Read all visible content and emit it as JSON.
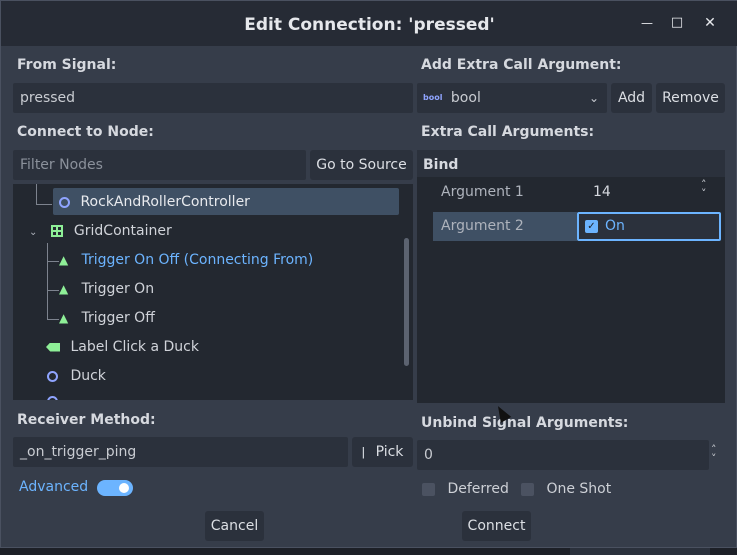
{
  "window": {
    "title": "Edit Connection: 'pressed'",
    "minimize_glyph": "—",
    "maximize_glyph": "□",
    "close_glyph": "✕"
  },
  "left": {
    "from_signal_label": "From Signal:",
    "from_signal_value": "pressed",
    "connect_to_node_label": "Connect to Node:",
    "filter_placeholder": "Filter Nodes",
    "go_to_source_label": "Go to Source",
    "tree": [
      {
        "label": "RockAndRollerController",
        "icon": "node-circle-icon",
        "selected": true
      },
      {
        "label": "GridContainer",
        "icon": "grid-container-icon",
        "expanded": true
      },
      {
        "label": "Trigger On Off (Connecting From)",
        "icon": "button-icon",
        "highlight": true
      },
      {
        "label": "Trigger On",
        "icon": "button-icon"
      },
      {
        "label": "Trigger Off",
        "icon": "button-icon"
      },
      {
        "label": "Label Click a Duck",
        "icon": "label-icon"
      },
      {
        "label": "Duck",
        "icon": "node-circle-icon"
      }
    ],
    "receiver_method_label": "Receiver Method:",
    "receiver_method_value": "_on_trigger_ping",
    "pick_label": "Pick",
    "advanced_label": "Advanced"
  },
  "right": {
    "add_extra_label": "Add Extra Call Argument:",
    "type_value": "bool",
    "type_icon_text": "bool",
    "add_label": "Add",
    "remove_label": "Remove",
    "extra_args_label": "Extra Call Arguments:",
    "bind_label": "Bind",
    "arguments": [
      {
        "name": "Argument 1",
        "value": "14"
      },
      {
        "name": "Argument 2",
        "value": "On",
        "checked": true
      }
    ],
    "unbind_label": "Unbind Signal Arguments:",
    "unbind_value": "0",
    "deferred_label": "Deferred",
    "one_shot_label": "One Shot"
  },
  "footer": {
    "cancel_label": "Cancel",
    "connect_label": "Connect"
  },
  "colors": {
    "accent": "#6cb4ff",
    "node_icon": "#8fa4ff",
    "control_icon": "#8eef97"
  }
}
